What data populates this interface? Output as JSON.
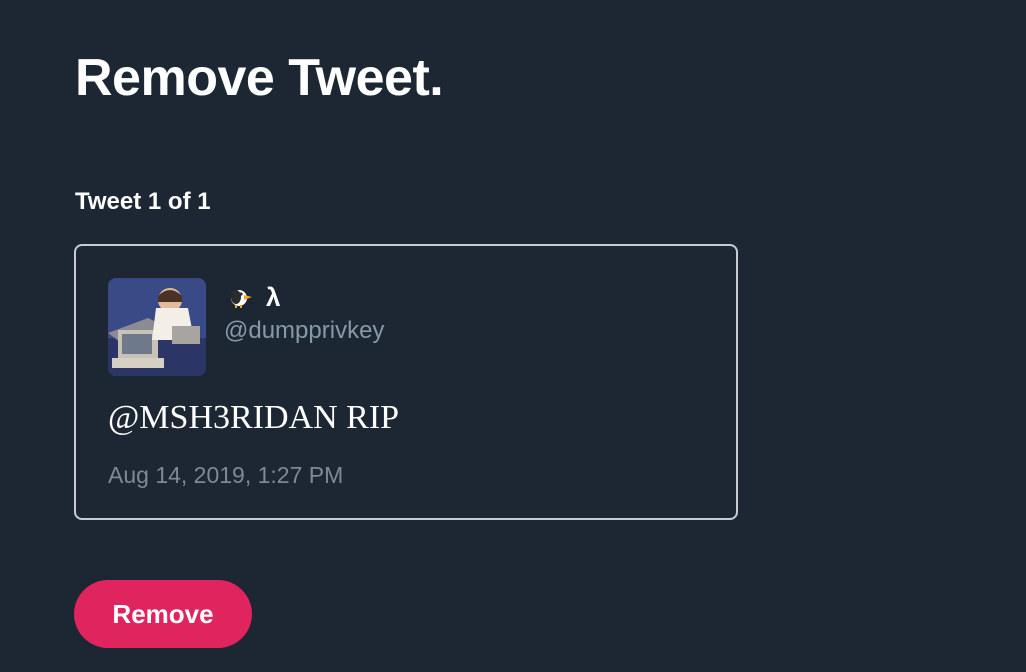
{
  "page": {
    "title": "Remove Tweet."
  },
  "progress": {
    "label": "Tweet 1 of 1"
  },
  "tweet": {
    "author_icon": "bird-icon",
    "display_name": "λ",
    "handle": "@dumpprivkey",
    "text": "@MSH3RIDAN RIP",
    "timestamp": "Aug 14, 2019, 1:27 PM"
  },
  "actions": {
    "remove_label": "Remove"
  },
  "colors": {
    "background": "#1c2733",
    "accent": "#e0245e",
    "secondary_text": "#8899a6",
    "card_border": "#c8ccd1"
  }
}
